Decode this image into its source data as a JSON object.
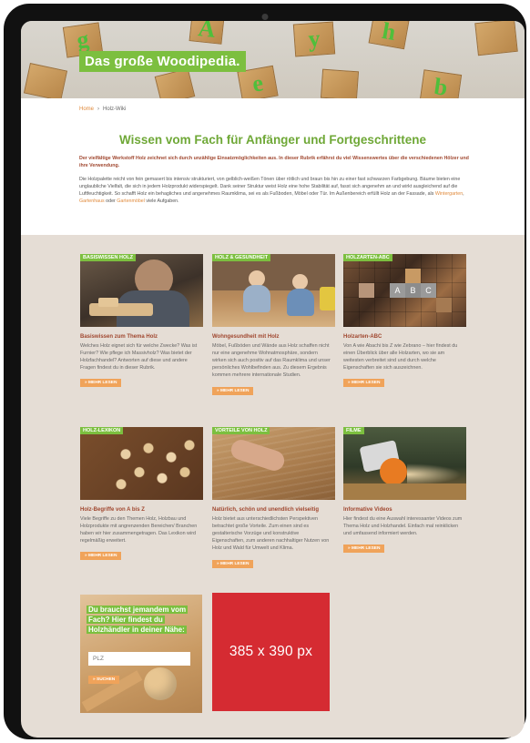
{
  "hero": {
    "title": "Das große Woodipedia.",
    "blocks": [
      "g",
      "A",
      "y",
      "h",
      "e",
      "b"
    ]
  },
  "breadcrumb": {
    "home": "Home",
    "separator": "›",
    "current": "Holz-Wiki"
  },
  "intro": {
    "heading": "Wissen vom Fach für Anfänger und Fortgeschrittene",
    "lead": "Der vielfältige Werkstoff Holz zeichnet sich durch unzählige Einsatzmöglichkeiten aus. In dieser Rubrik erfährst du viel Wissenswertes über die verschiedenen Hölzer und ihre Verwendung.",
    "body_main": "Die Holzpalette reicht von fein gemasert bis intensiv strukturiert, von gelblich-weißen Tönen über rötlich und braun bis hin zu einer fast schwarzen Farbgebung. Bäume bieten eine unglaubliche Vielfalt, die sich in jedem Holzprodukt widerspiegelt. Dank seiner Struktur weist Holz eine hohe Stabilität auf, fasst sich angenehm an und wirkt ausgleichend auf die Luftfeuchtigkeit. So schafft Holz ein behagliches und angenehmes Raumklima, sei es als Fußboden, Möbel oder Tür. Im Außenbereich erfüllt Holz an der Fassade,",
    "body_als": "als",
    "link1": "Wintergarten",
    "comma": ",",
    "link2": "Gartenhaus",
    "oder": "oder",
    "link3": "Gartenmöbel",
    "body_end": "viele Aufgaben."
  },
  "cards": [
    {
      "label": "BASISWISSEN HOLZ",
      "title": "Basiswissen zum Thema Holz",
      "text": "Welches Holz eignet sich für welche Zwecke? Was ist Furnier? Wie pflege ich Massivholz? Was bietet der Holzfachhandel? Antworten auf diese und andere Fragen findest du in dieser Rubrik.",
      "button": "» MEHR LESEN"
    },
    {
      "label": "HOLZ & GESUNDHEIT",
      "title": "Wohngesundheit mit Holz",
      "text": "Möbel, Fußböden und Wände aus Holz schaffen nicht nur eine angenehme Wohnatmosphäre, sondern wirken sich auch positiv auf das Raumklima und unser persönliches Wohlbefinden aus. Zu diesem Ergebnis kommen mehrere internationale Studien.",
      "button": "» MEHR LESEN"
    },
    {
      "label": "HOLZARTEN-ABC",
      "title": "Holzarten-ABC",
      "text": "Von A wie Abachi bis Z wie Zebrano – hier findest du einen Überblick über alle Holzarten, wo sie am weitesten verbreitet sind und durch welche Eigenschaften sie sich auszeichnen.",
      "button": "» MEHR LESEN",
      "tiles": [
        "A",
        "B",
        "C"
      ]
    },
    {
      "label": "HOLZ-LEXIKON",
      "title": "Holz-Begriffe von A bis Z",
      "text": "Viele Begriffe zu den Themen Holz, Holzbau und Holzprodukte mit angrenzenden Bereichen/ Branchen haben wir hier zusammengetragen. Das Lexikon wird regelmäßig erweitert.",
      "button": "» MEHR LESEN"
    },
    {
      "label": "VORTEILE VON HOLZ",
      "title": "Natürlich, schön und unendlich vielseitig",
      "text": "Holz bietet aus unterschiedlichsten Perspektiven betrachtet große Vorteile. Zum einen sind es gestalterische Vorzüge und konstruktive Eigenschaften, zum anderen nachhaltiger Nutzen von Holz und Wald für Umwelt und Klima.",
      "button": "» MEHR LESEN"
    },
    {
      "label": "FILME",
      "title": "Informative Videos",
      "text": "Hier findest du eine Auswahl interessanter Videos zum Thema Holz und Holzhandel. Einfach mal reinklicken und umfassend informiert werden.",
      "button": "» MEHR LESEN"
    }
  ],
  "search": {
    "heading": "Du brauchst jemandem vom Fach? Hier findest du Holzhändler in deiner Nähe:",
    "placeholder": "PLZ",
    "button": "» SUCHEN"
  },
  "ad": {
    "text": "385 x 390 px"
  },
  "colors": {
    "accent_green": "#7cbf3f",
    "heading_green": "#6fa837",
    "button_orange": "#f0a35a",
    "title_brown": "#a0472f",
    "ad_red": "#d52b32",
    "page_beige": "#e5ddd5"
  }
}
